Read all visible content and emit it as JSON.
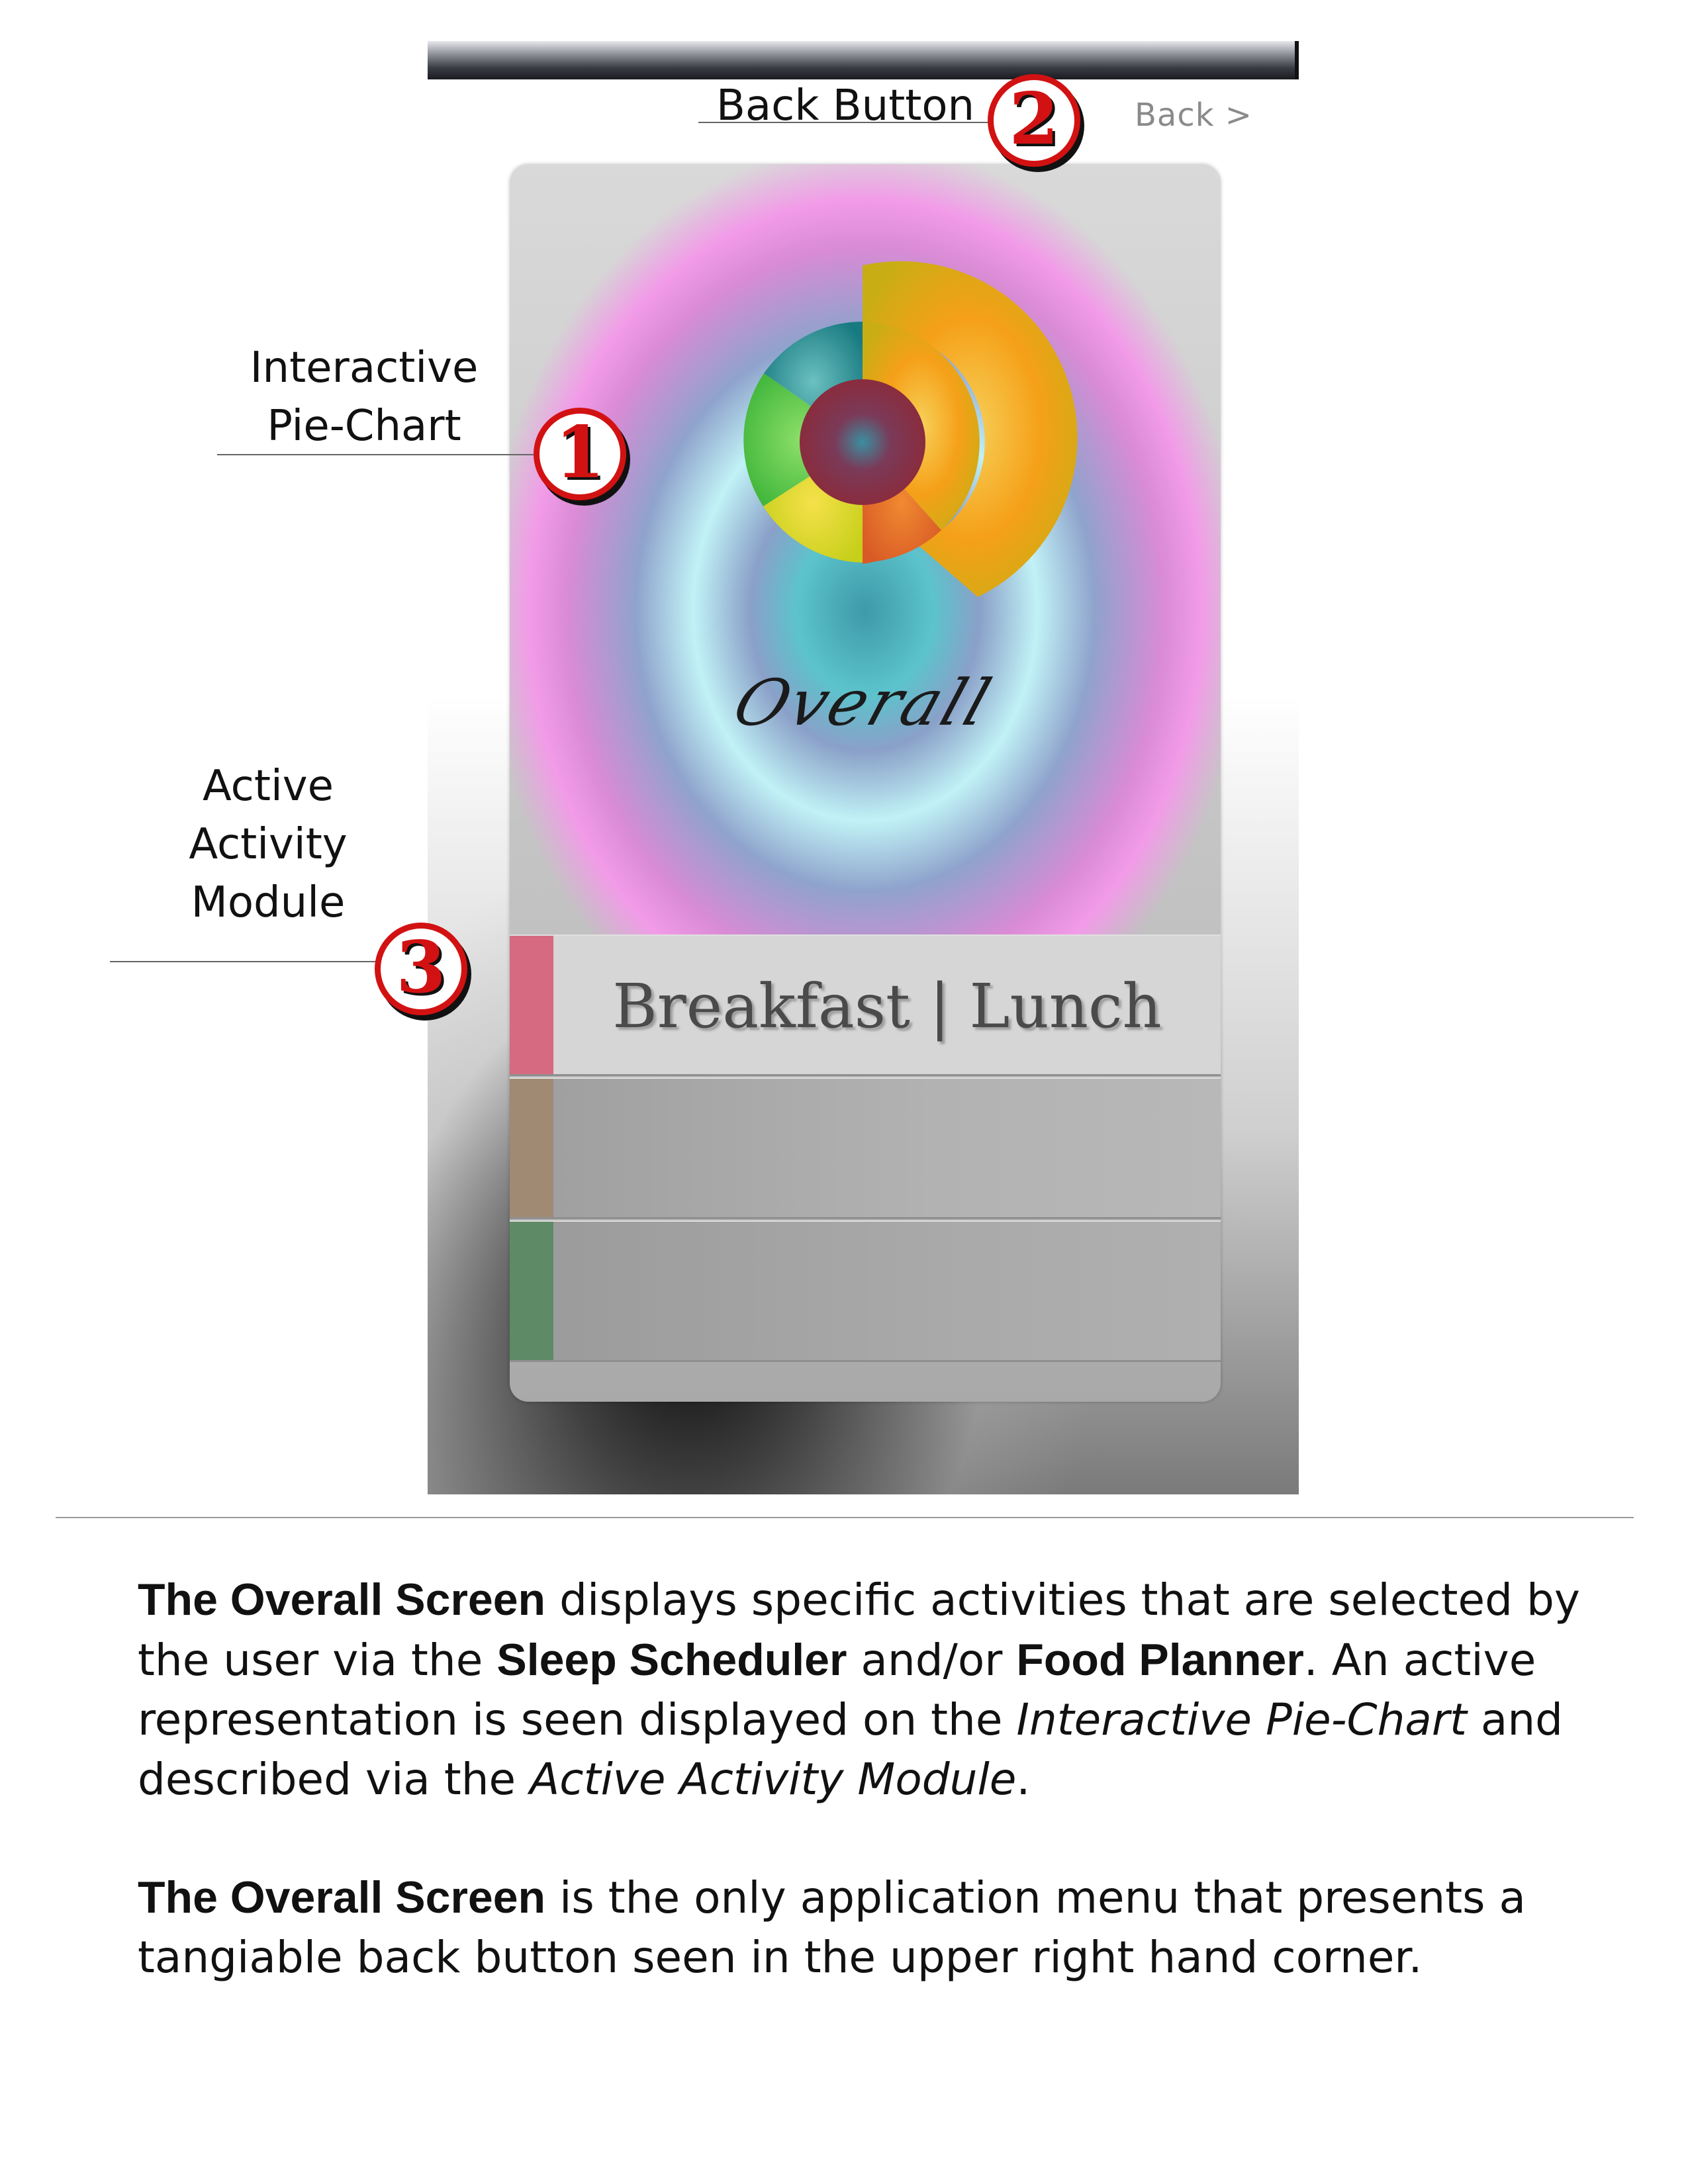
{
  "phone": {
    "back_label": "Back >",
    "overall_label": "Overall"
  },
  "pie": {
    "segments": [
      {
        "name": "teal",
        "color": "#1f7f86",
        "start_deg": 0,
        "end_deg": 0
      },
      {
        "name": "orange",
        "color": "#f4a21a"
      },
      {
        "name": "red-orange",
        "color": "#e76d2b"
      },
      {
        "name": "yellow",
        "color": "#e6cf1a"
      },
      {
        "name": "green",
        "color": "#53c23e"
      }
    ],
    "center_color": "#7a2e4a"
  },
  "module": {
    "active_title": "Breakfast | Lunch",
    "stripe_colors": [
      "#d56a80",
      "#a08a73",
      "#5f8a66"
    ]
  },
  "annotations": {
    "one": {
      "num": "1",
      "label_line1": "Interactive",
      "label_line2": "Pie-Chart"
    },
    "two": {
      "num": "2",
      "label": "Back Button"
    },
    "three": {
      "num": "3",
      "label_line1": "Active",
      "label_line2": "Activity",
      "label_line3": "Module"
    }
  },
  "description": {
    "p1": {
      "bold1": "The Overall Screen",
      "text1": " displays specific activities that are selected by the user via the ",
      "bold2": "Sleep Scheduler",
      "text2": " and/or ",
      "bold3": "Food Planner",
      "text3": ". An active representation is seen displayed on the ",
      "italic1": "Interactive Pie-Chart",
      "text4": " and described via the ",
      "italic2": "Active Activity Module",
      "text5": "."
    },
    "p2": {
      "bold1": "The Overall Screen",
      "text1": " is the only application menu that presents a tangiable back button seen in the upper right hand corner."
    }
  }
}
